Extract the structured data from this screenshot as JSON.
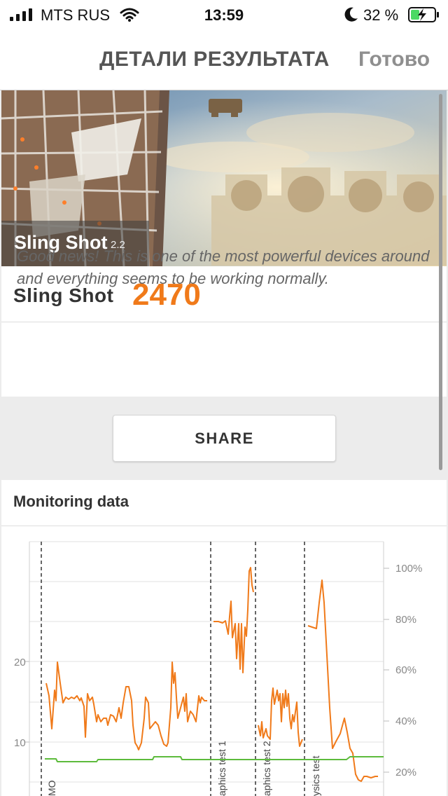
{
  "status": {
    "carrier": "MTS RUS",
    "time": "13:59",
    "battery": "32 %"
  },
  "nav": {
    "title": "ДЕТАЛИ РЕЗУЛЬТАТА",
    "done": "Готово"
  },
  "hero": {
    "name": "Sling Shot",
    "version": "2.2"
  },
  "result": {
    "name": "Sling Shot",
    "score": "2470"
  },
  "description": "Good news! This is one of the most powerful devices around and everything seems to be working normally.",
  "share_label": "SHARE",
  "monitoring": {
    "title": "Monitoring data",
    "chart_data": {
      "type": "line",
      "y_left": {
        "ticks": [
          "10",
          "20"
        ]
      },
      "y_right": {
        "ticks": [
          "20%",
          "40%",
          "60%",
          "80%",
          "100%"
        ]
      },
      "segments": [
        "MO",
        "aphics test 1",
        "aphics test 2",
        "ysics test"
      ],
      "series": [
        {
          "name": "",
          "color": "#f07a1a",
          "points": [
            [
              66,
              975
            ],
            [
              70,
              993
            ],
            [
              74,
              1040
            ],
            [
              78,
              985
            ],
            [
              80,
              1000
            ],
            [
              82,
              945
            ],
            [
              86,
              975
            ],
            [
              90,
              1003
            ],
            [
              94,
              995
            ],
            [
              98,
              998
            ],
            [
              102,
              995
            ],
            [
              106,
              997
            ],
            [
              110,
              993
            ],
            [
              114,
              1000
            ],
            [
              116,
              996
            ],
            [
              120,
              1008
            ],
            [
              122,
              1052
            ],
            [
              125,
              990
            ],
            [
              128,
              1000
            ],
            [
              132,
              995
            ],
            [
              134,
              1005
            ],
            [
              138,
              1030
            ],
            [
              140,
              1020
            ],
            [
              144,
              1030
            ],
            [
              148,
              1025
            ],
            [
              152,
              1025
            ],
            [
              154,
              1035
            ],
            [
              158,
              1020
            ],
            [
              162,
              1022
            ],
            [
              166,
              1030
            ],
            [
              170,
              1010
            ],
            [
              173,
              1025
            ],
            [
              176,
              1003
            ],
            [
              180,
              980
            ],
            [
              184,
              980
            ],
            [
              188,
              1000
            ],
            [
              190,
              1035
            ],
            [
              193,
              1060
            ],
            [
              196,
              1065
            ],
            [
              198,
              1070
            ],
            [
              202,
              1060
            ],
            [
              206,
              1025
            ],
            [
              208,
              995
            ],
            [
              212,
              1003
            ],
            [
              214,
              1040
            ],
            [
              218,
              1035
            ],
            [
              222,
              1030
            ],
            [
              226,
              1035
            ],
            [
              230,
              1050
            ],
            [
              234,
              1062
            ],
            [
              238,
              1065
            ],
            [
              240,
              1060
            ],
            [
              244,
              1010
            ],
            [
              246,
              945
            ],
            [
              248,
              975
            ],
            [
              250,
              960
            ],
            [
              252,
              995
            ],
            [
              254,
              1025
            ],
            [
              258,
              1010
            ],
            [
              262,
              995
            ],
            [
              264,
              1015
            ],
            [
              266,
              990
            ],
            [
              268,
              1030
            ],
            [
              272,
              1015
            ],
            [
              276,
              1020
            ],
            [
              280,
              1030
            ],
            [
              284,
              993
            ],
            [
              286,
              1003
            ],
            [
              288,
              995
            ],
            [
              292,
              1000
            ],
            [
              296,
              1000
            ]
          ]
        },
        {
          "name": "",
          "color": "#f07a1a",
          "points": [
            [
              305,
              887
            ],
            [
              312,
              887
            ],
            [
              318,
              889
            ],
            [
              322,
              886
            ],
            [
              326,
              905
            ],
            [
              328,
              880
            ],
            [
              330,
              858
            ],
            [
              332,
              910
            ],
            [
              336,
              890
            ],
            [
              338,
              940
            ],
            [
              341,
              890
            ],
            [
              343,
              955
            ],
            [
              345,
              890
            ],
            [
              347,
              960
            ],
            [
              350,
              895
            ],
            [
              352,
              908
            ],
            [
              354,
              870
            ],
            [
              356,
              815
            ],
            [
              358,
              810
            ],
            [
              360,
              835
            ],
            [
              362,
              845
            ]
          ]
        },
        {
          "name": "",
          "color": "#f07a1a",
          "points": [
            [
              369,
              1035
            ],
            [
              372,
              1050
            ],
            [
              374,
              1030
            ],
            [
              376,
              1053
            ],
            [
              380,
              1040
            ],
            [
              382,
              1050
            ],
            [
              386,
              1055
            ],
            [
              388,
              1000
            ],
            [
              390,
              982
            ],
            [
              392,
              1005
            ],
            [
              396,
              985
            ],
            [
              398,
              1000
            ],
            [
              400,
              990
            ],
            [
              402,
              1030
            ],
            [
              404,
              990
            ],
            [
              406,
              1010
            ],
            [
              408,
              985
            ],
            [
              410,
              1008
            ],
            [
              412,
              990
            ],
            [
              414,
              1025
            ],
            [
              416,
              1040
            ],
            [
              418,
              1020
            ],
            [
              420,
              1030
            ],
            [
              424,
              1002
            ],
            [
              426,
              1045
            ],
            [
              428,
              1065
            ],
            [
              432,
              1055
            ]
          ]
        },
        {
          "name": "",
          "color": "#f07a1a",
          "points": [
            [
              440,
              893
            ],
            [
              452,
              897
            ],
            [
              456,
              860
            ],
            [
              460,
              828
            ],
            [
              463,
              860
            ],
            [
              467,
              935
            ],
            [
              471,
              1010
            ],
            [
              475,
              1068
            ],
            [
              480,
              1058
            ],
            [
              486,
              1047
            ],
            [
              492,
              1025
            ],
            [
              496,
              1045
            ],
            [
              500,
              1068
            ],
            [
              504,
              1075
            ],
            [
              508,
              1105
            ],
            [
              512,
              1113
            ],
            [
              516,
              1115
            ],
            [
              520,
              1108
            ],
            [
              524,
              1108
            ],
            [
              530,
              1110
            ],
            [
              536,
              1108
            ],
            [
              540,
              1108
            ]
          ]
        },
        {
          "name": "",
          "color": "#5dbb3c",
          "points": [
            [
              64,
              1083
            ],
            [
              80,
              1083
            ],
            [
              82,
              1087
            ],
            [
              138,
              1087
            ],
            [
              140,
              1084
            ],
            [
              218,
              1084
            ],
            [
              220,
              1080
            ],
            [
              258,
              1080
            ],
            [
              260,
              1084
            ],
            [
              495,
              1084
            ],
            [
              500,
              1080
            ],
            [
              548,
              1080
            ]
          ]
        }
      ]
    }
  }
}
